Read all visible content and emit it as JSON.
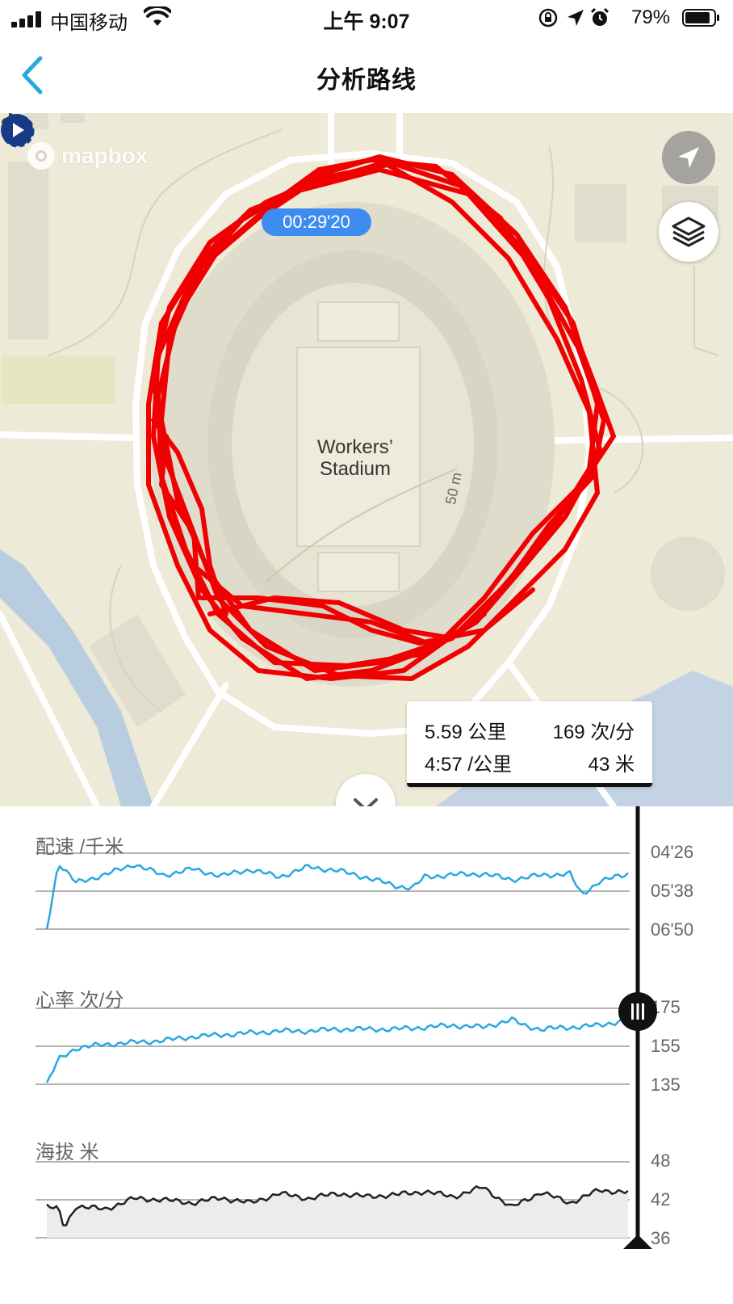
{
  "status_bar": {
    "carrier": "中国移动",
    "time": "上午 9:07",
    "battery_percent": "79%"
  },
  "nav": {
    "back_icon": "chevron-left-icon",
    "title": "分析路线",
    "accent_color": "#29a8e0"
  },
  "map": {
    "attribution": "mapbox",
    "stadium_line1": "Workers’",
    "stadium_line2": "Stadium",
    "scale_label": "50 m",
    "elapsed_time": "00:29'20",
    "route_color": "#f00000",
    "bubble_color": "#3f8cf0"
  },
  "stats_popup": {
    "distance": "5.59 公里",
    "cadence": "169 次/分",
    "pace": "4:57 /公里",
    "altitude": "43 米"
  },
  "charts": {
    "pace": {
      "title": "配速 /千米",
      "ticks": [
        "04'26",
        "05'38",
        "06'50"
      ],
      "color": "#29a8e0"
    },
    "heart_rate": {
      "title": "心率 次/分",
      "ticks": [
        "175",
        "155",
        "135"
      ],
      "color": "#29a8e0"
    },
    "altitude": {
      "title": "海拔 米",
      "ticks": [
        "48",
        "42",
        "36"
      ],
      "color": "#222222"
    }
  },
  "chart_data": [
    {
      "type": "line",
      "title": "配速 /千米",
      "ylabel": "pace (min:sec per km)",
      "y_ticks": [
        "04'26",
        "05'38",
        "06'50"
      ],
      "ylim_seconds": [
        266,
        410
      ],
      "x": [
        0,
        0.02,
        0.05,
        0.1,
        0.15,
        0.2,
        0.25,
        0.3,
        0.35,
        0.4,
        0.45,
        0.5,
        0.55,
        0.6,
        0.63,
        0.65,
        0.7,
        0.75,
        0.8,
        0.85,
        0.9,
        0.92,
        0.95,
        1.0
      ],
      "series": [
        {
          "values": [
            410,
            284,
            322,
            307,
            287,
            308,
            296,
            309,
            297,
            311,
            292,
            299,
            312,
            328,
            332,
            311,
            307,
            305,
            316,
            308,
            305,
            345,
            320,
            305
          ]
        }
      ]
    },
    {
      "type": "line",
      "title": "心率 次/分",
      "y_ticks": [
        "175",
        "155",
        "135"
      ],
      "ylim": [
        135,
        175
      ],
      "x": [
        0,
        0.02,
        0.05,
        0.1,
        0.15,
        0.2,
        0.25,
        0.3,
        0.35,
        0.4,
        0.45,
        0.5,
        0.55,
        0.6,
        0.65,
        0.7,
        0.75,
        0.8,
        0.82,
        0.85,
        0.9,
        0.95,
        1.0
      ],
      "series": [
        {
          "values": [
            135,
            148,
            154,
            156,
            157,
            158,
            160,
            161,
            162,
            163,
            163,
            164,
            164,
            164,
            165,
            166,
            165,
            169,
            166,
            164,
            165,
            166,
            169
          ]
        }
      ]
    },
    {
      "type": "area",
      "title": "海拔 米",
      "y_ticks": [
        "48",
        "42",
        "36"
      ],
      "ylim": [
        36,
        48
      ],
      "x": [
        0,
        0.02,
        0.03,
        0.05,
        0.1,
        0.15,
        0.2,
        0.25,
        0.3,
        0.35,
        0.4,
        0.45,
        0.5,
        0.55,
        0.6,
        0.65,
        0.7,
        0.75,
        0.8,
        0.85,
        0.9,
        0.95,
        1.0
      ],
      "series": [
        {
          "values": [
            41,
            40.5,
            37.5,
            41,
            40.5,
            42.2,
            42,
            41.5,
            42.3,
            41.5,
            43,
            42.2,
            43,
            42.5,
            42.8,
            43.3,
            42.5,
            44,
            40.8,
            43.2,
            41.5,
            43.5,
            43.2
          ]
        }
      ]
    }
  ]
}
